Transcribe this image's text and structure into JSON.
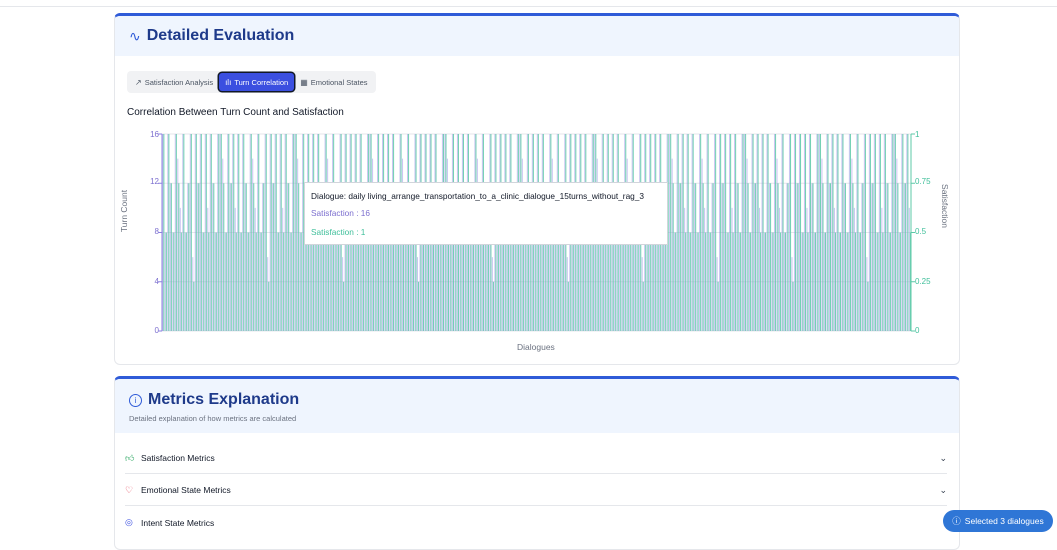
{
  "evaluation": {
    "title": "Detailed Evaluation",
    "icon": "activity-icon",
    "tabs": [
      {
        "label": "Satisfaction Analysis",
        "icon": "trend-up-icon",
        "active": false
      },
      {
        "label": "Turn Correlation",
        "icon": "bar-chart-icon",
        "active": true
      },
      {
        "label": "Emotional States",
        "icon": "table-icon",
        "active": false
      }
    ],
    "chart_title": "Correlation Between Turn Count and Satisfaction"
  },
  "chart_data": {
    "type": "bar",
    "title": "Correlation Between Turn Count and Satisfaction",
    "xlabel": "Dialogues",
    "ylabel_left": "Turn Count",
    "ylabel_right": "Satisfaction",
    "ylim_left": [
      0,
      16
    ],
    "ylim_right": [
      0,
      1
    ],
    "yticks_left": [
      "0",
      "4",
      "8",
      "12",
      "16"
    ],
    "yticks_right": [
      "0",
      "0.25",
      "0.5",
      "0.75",
      "1"
    ],
    "colors": {
      "turns": "#8b80e0",
      "satisfaction": "#5cc9a7"
    },
    "pattern_turns": [
      16,
      8,
      16,
      12,
      8,
      16,
      14,
      10,
      16,
      8,
      12,
      16,
      6,
      16,
      12,
      16,
      8,
      16,
      10,
      16,
      12,
      8,
      16,
      16,
      14,
      8,
      16,
      12,
      16,
      10
    ],
    "pattern_satisfaction": [
      1,
      0.5,
      1,
      0.75,
      0.5,
      1,
      0.75,
      0.5,
      1,
      0.5,
      0.75,
      1,
      0.25,
      1,
      0.75,
      1,
      0.5,
      1,
      0.5,
      1,
      0.75,
      0.5,
      1,
      1,
      0.75,
      0.5,
      1,
      0.75,
      1,
      0.5
    ],
    "bar_count": 300
  },
  "tooltip": {
    "dialogue": "Dialogue: daily living_arrange_transportation_to_a_clinic_dialogue_15turns_without_rag_3",
    "turns": "Satisfaction : 16",
    "satisfaction": "Satisfaction : 1"
  },
  "metrics": {
    "title": "Metrics Explanation",
    "icon": "info-icon",
    "subtitle": "Detailed explanation of how metrics are calculated",
    "items": [
      {
        "label": "Satisfaction Metrics",
        "icon": "thumbs-up-icon",
        "color": "#22a35a"
      },
      {
        "label": "Emotional State Metrics",
        "icon": "heart-icon",
        "color": "#e0364b"
      },
      {
        "label": "Intent State Metrics",
        "icon": "target-icon",
        "color": "#3b4fe0"
      }
    ]
  },
  "floating": {
    "label": "Selected 3 dialogues",
    "icon": "info-icon"
  }
}
